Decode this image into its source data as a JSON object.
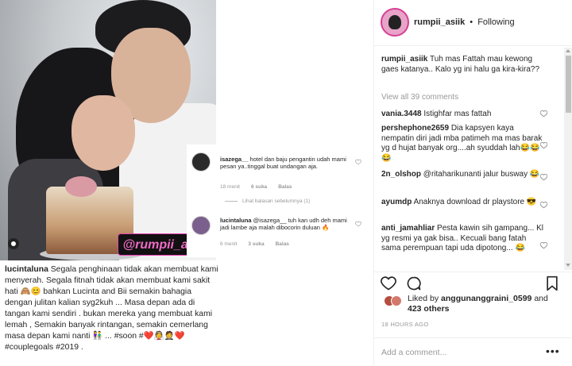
{
  "photo": {
    "watermark": "@rumpii_asiik"
  },
  "overlay": {
    "comment1": {
      "username": "isazega__",
      "text": " hotel dan baju pengantin udah mami pesan ya..tinggal buat undangan aja.",
      "time": "18 menit",
      "likes": "6 suka",
      "reply": "Balas"
    },
    "view_previous": "Lihat balasan sebelumnya (1)",
    "comment2": {
      "username": "lucintaluna",
      "text": " @isazega__ tuh kan udh deh mami jadi lambe aja malah dibocorin duluan 🔥",
      "time": "6 menit",
      "likes": "3 suka",
      "reply": "Balas"
    }
  },
  "caption": {
    "username": "lucintaluna",
    "text": " Segala penghinaan tidak akan membuat kami menyerah. Segala fitnah tidak akan membuat kami sakit hati 🙈😊 bahkan Lucinta and Bii semakin bahagia dengan julitan kalian syg2kuh ... Masa depan ada di tangan kami sendiri . bukan mereka yang membuat kami lemah , Semakin banyak rintangan, semakin cemerlang masa depan kami nanti 👫 ... #soon #❤️👰🤵❤️ #couplegoals #2019 ."
  },
  "header": {
    "username": "rumpii_asiik",
    "dot": "•",
    "follow_status": "Following"
  },
  "comments": {
    "owner": {
      "username": "rumpii_asiik",
      "text": " Tuh mas Fattah mau kewong gaes katanya.. Kalo yg ini halu ga kira-kira??"
    },
    "view_all": "View all 39 comments",
    "items": [
      {
        "username": "vania.3448",
        "text": " Istighfar mas fattah"
      },
      {
        "username": "pershephone2659",
        "text": " Dia kapsyen kaya nempatin diri jadi mba patimeh ma mas barak yg d hujat banyak org....ah syuddah lah😂😂😂"
      },
      {
        "username": "2n_olshop",
        "text": " @ritaharikunanti jalur busway 😂"
      },
      {
        "username": "ayumdp",
        "text": " Anaknya download dr playstore 😎"
      },
      {
        "username": "anti_jamahliar",
        "text": " Pesta kawin sih gampang... Kl yg resmi ya gak bisa.. Kecuali bang fatah sama perempuan tapi uda dipotong... 😂"
      }
    ]
  },
  "likes": {
    "prefix": "Liked by ",
    "user": "anggunanggraini_0599",
    "and": " and",
    "others": "423 others"
  },
  "timestamp": "18 HOURS AGO",
  "add_comment": {
    "placeholder": "Add a comment...",
    "more": "•••"
  },
  "icons": {
    "heart": "heart-icon",
    "comment": "comment-icon",
    "bookmark": "bookmark-icon"
  }
}
